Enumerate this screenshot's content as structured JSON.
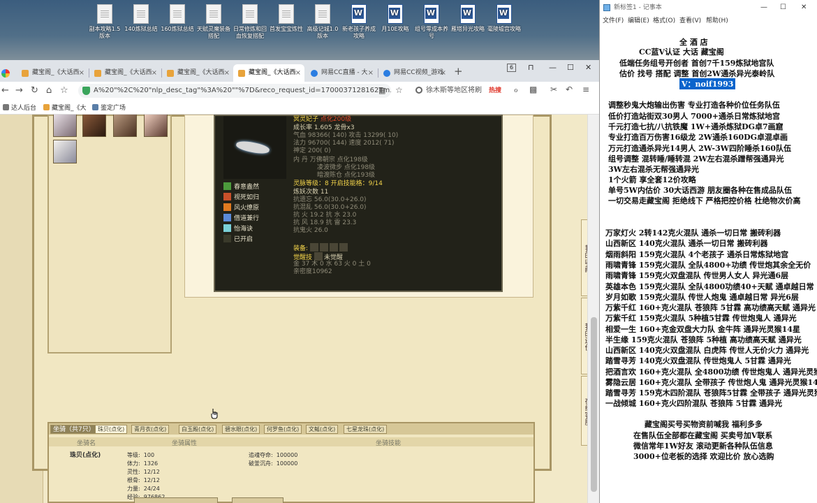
{
  "desktop": {
    "icons": [
      {
        "label": "副本攻略1.5版本",
        "type": "file"
      },
      {
        "label": "140炼狱总结",
        "type": "file"
      },
      {
        "label": "160炼狱总结",
        "type": "file"
      },
      {
        "label": "天赋灵魔装备搭配",
        "type": "file"
      },
      {
        "label": "日常修炼和回血恢复搭配",
        "type": "file"
      },
      {
        "label": "首发宝宝炼性",
        "type": "file"
      },
      {
        "label": "高级记城1.0版本",
        "type": "file"
      },
      {
        "label": "新老孩子养成攻略",
        "type": "word"
      },
      {
        "label": "月10E攻略",
        "type": "word"
      },
      {
        "label": "组号零成本养号",
        "type": "word"
      },
      {
        "label": "雁塔异光攻略",
        "type": "word"
      },
      {
        "label": "毫陵墟宫攻略",
        "type": "word"
      }
    ]
  },
  "browser": {
    "tabs": [
      {
        "label": "藏宝阁_《大话西",
        "active": false,
        "icon": "treasure-icon"
      },
      {
        "label": "藏宝阁_《大话西",
        "active": false,
        "icon": "treasure-icon"
      },
      {
        "label": "藏宝阁_《大话西",
        "active": false,
        "icon": "treasure-icon"
      },
      {
        "label": "藏宝阁_《大话西",
        "active": true,
        "icon": "treasure-icon"
      },
      {
        "label": "网易CC直播 - 大",
        "active": false,
        "icon": "cc-icon"
      },
      {
        "label": "网易CC视频_游戏",
        "active": false,
        "icon": "cc-icon"
      }
    ],
    "tab_count": "6",
    "url": "A%20\"%2C%20\"nlp_desc_tag\"%3A%20\"\"%7D&reco_request_id=1700037128162Tm30t",
    "search_text": "徐木斯等地区将刷",
    "search_hot": "热搜",
    "bookmarks": [
      "达人后台",
      "藏宝阁_《大",
      "鉴定广场"
    ]
  },
  "pet": {
    "name": "冥灵妃子",
    "name_suffix": "点化200级",
    "lines": [
      "成长率 1.605 龙骨x3",
      "气血 98366( 140) 攻击 13299( 10)",
      "法力 96700( 144) 速度 2012( 71)",
      "神定 200( 0)",
      "内 丹 万佛朝宗 点化198级",
      "凌波微步 点化198级",
      "暗渡陈仓 点化193级"
    ],
    "skills": [
      "春意盎然",
      "视死如归",
      "风火燎原",
      "借道兼行",
      "怡海诀",
      "已开启"
    ],
    "soul_level": "灵脉等级：8 开启技能格：9/14",
    "lines2": [
      "炼妖次数 11",
      "抗遗忘 56.0(30.0+26.0)",
      "抗混乱 56.0(30.0+26.0)",
      "抗 火 19.2 抗 水 23.0",
      "抗 风 18.9 抗 雷 23.3",
      "抗鬼火 26.0"
    ],
    "equip_label": "装备:",
    "awaken_label": "觉醒技",
    "awaken_value": "未觉醒",
    "elements": "金 37 木 0 水 63 火 0 土 0",
    "affinity": "亲密度10962"
  },
  "mount": {
    "count_tab": "坐骑（共7只）",
    "tabs": [
      "珠贝(点化)",
      "青月衣(点化)",
      "白玉殿(点化)",
      "碧水眼(点化)",
      "何罗鱼(点化)",
      "文鳐(点化)",
      "七星龙珠(点化)"
    ],
    "headers": [
      "坐骑名",
      "坐骑属性",
      "坐骑技能"
    ],
    "name": "珠贝(点化)",
    "attrs": [
      {
        "k": "等级",
        "v": "100"
      },
      {
        "k": "体力",
        "v": "1326"
      },
      {
        "k": "灵性",
        "v": "12/12"
      },
      {
        "k": "根骨",
        "v": "12/12"
      },
      {
        "k": "力量",
        "v": "24/24"
      },
      {
        "k": "经验",
        "v": "976862"
      }
    ],
    "skills": [
      {
        "k": "追魂夺命",
        "v": "100000"
      },
      {
        "k": "破釜沉舟",
        "v": "100000"
      }
    ]
  },
  "right_strip": [
    "我的收藏",
    "我的还价",
    "在线客服"
  ],
  "notepad": {
    "title": "新标签1 - 记事本",
    "menu": [
      "文件(F)",
      "编辑(E)",
      "格式(O)",
      "查看(V)",
      "帮助(H)"
    ],
    "header": [
      "全   酒    店",
      "CC蓝V认证 大话  藏宝阁",
      "低端任务组号开创者          首创7千159炼狱地宫队",
      "估价 找号 搭配 调整          首创2W通杀异光泰岭队"
    ],
    "wechat": "V：noif1993",
    "services": [
      "调整秒鬼大炮输出伤害            专业打造各种价位任务队伍",
      "低价打造站街双30男人               7000+通杀日常炼狱地宫",
      "千元打造七抗/八抗铁魔            1W+通杀炼狱DG卓7画窟",
      "专业打造百万伤害16级龙           2W通杀160DG卓混卓画",
      "万元打造通杀异光14男人         2W-3W四阶睡杀160队伍",
      "组号调整 混转睡/睡转混         2W左右混杀蹭帮强通异光",
      "                                           3W左右混杀无帮强通异光",
      "1个火箭 享全套12价攻略",
      "单号5W内估价 30大话西游          朋友圈各种在售成品队伍",
      "一切交易走藏宝阁 拒绝线下     严格把控价格 杜绝物次价高"
    ],
    "teams": [
      "万家灯火 2转142克火混队 通杀一切日常 搬砖利器",
      "山西新区 140克火混队 通杀一切日常 搬砖利器",
      "烟雨斜阳 159克火混队 4个老孩子 通杀日常炼狱地宫",
      "雨啸青锋 159克火混队 全队4800+功绩 传世炮其余全无价",
      "雨啸青锋 159克火双盘混队 传世男人女人 异光通6层",
      "英雄本色 159克火混队 全队4800功绩40+天赋 通卓越日常",
      "岁月如歌 159克火混队 传世人炮鬼 通卓越日常 异光6层",
      "万紫千红 160+克火混队 苍狼阵 5甘霖 高功绩高天赋 通异光",
      "万紫千红 159克火混队 5种植5甘霖 传世炮鬼人 通异光",
      "相爱一生 160+克金双盘大力队 金牛阵 通异光灵猴14星",
      "半生缘    159克火混队 苍狼阵 5种植 高功绩高天赋 通异光",
      "山西新区 140克火双盘混队 白虎阵 传世人无价火力 通异光",
      "踏雪寻芳 140克火双盘混队 传世炮鬼人 5甘霖 通异光",
      "把酒言欢 160+克火混队 全4800功绩 传世炮鬼人 通异光灵猴",
      "雾隐云居 160+克火混队 全带孩子 传世炮人鬼 通异光灵猴14",
      "踏雪寻芳 159克木四阶混队 苍狼阵5甘霖 全带孩子 通异光灵猴",
      "一战倾城 160+克火四阶混队 苍狼阵 5甘霖 通异光"
    ],
    "footer": [
      "藏宝阁买号买物资前喊我 福利多多",
      "在售队伍全部都在藏宝阁 买卖号加V联系",
      "微信常年1W好友 滚动更新各种队伍信息",
      "3000+位老板的选择 欢迎比价 放心选购"
    ]
  }
}
